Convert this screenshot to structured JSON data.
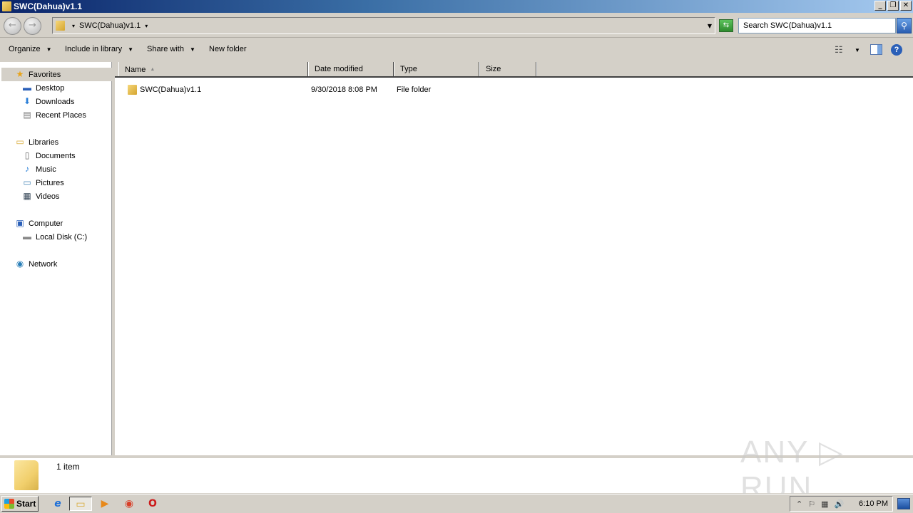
{
  "window": {
    "title": "SWC(Dahua)v1.1",
    "controls": {
      "minimize": "_",
      "restore": "❐",
      "close": "✕"
    }
  },
  "address_bar": {
    "breadcrumb": [
      "SWC(Dahua)v1.1"
    ],
    "back_icon": "←",
    "forward_icon": "→",
    "refresh_icon": "⇆",
    "search_placeholder": "Search SWC(Dahua)v1.1",
    "search_icon": "🔍"
  },
  "command_bar": {
    "organize": "Organize",
    "include_in_library": "Include in library",
    "share_with": "Share with",
    "new_folder": "New folder",
    "dropdown_arrow": "▼",
    "views_icon": "☷",
    "preview_icon": "◨",
    "help_icon": "?"
  },
  "nav_pane": {
    "groups": [
      {
        "label": "Favorites",
        "icon": "★",
        "selected": true,
        "items": [
          {
            "label": "Desktop",
            "icon": "▬"
          },
          {
            "label": "Downloads",
            "icon": "⬇"
          },
          {
            "label": "Recent Places",
            "icon": "▤"
          }
        ]
      },
      {
        "label": "Libraries",
        "icon": "▭",
        "items": [
          {
            "label": "Documents",
            "icon": "▯"
          },
          {
            "label": "Music",
            "icon": "♪"
          },
          {
            "label": "Pictures",
            "icon": "▭"
          },
          {
            "label": "Videos",
            "icon": "▦"
          }
        ]
      },
      {
        "label": "Computer",
        "icon": "▣",
        "items": [
          {
            "label": "Local Disk (C:)",
            "icon": "▬"
          }
        ]
      },
      {
        "label": "Network",
        "icon": "◉",
        "items": []
      }
    ]
  },
  "file_list": {
    "columns": [
      "Name",
      "Date modified",
      "Type",
      "Size"
    ],
    "sort_indicator": "▲",
    "rows": [
      {
        "name": "SWC(Dahua)v1.1",
        "date_modified": "9/30/2018 8:08 PM",
        "type": "File folder",
        "size": ""
      }
    ]
  },
  "details_pane": {
    "item_count": "1 item"
  },
  "watermark": "ANY ▷ RUN",
  "taskbar": {
    "start_label": "Start",
    "apps": [
      {
        "name": "Internet Explorer",
        "icon": "e"
      },
      {
        "name": "Windows Explorer",
        "icon": "▭",
        "active": true
      },
      {
        "name": "Windows Media Player",
        "icon": "▶"
      },
      {
        "name": "Chrome",
        "icon": "◉"
      },
      {
        "name": "Opera",
        "icon": "O"
      }
    ],
    "tray": {
      "show_hidden": "⌃",
      "flag_icon": "⚐",
      "network_icon": "▦",
      "volume_icon": "🔊",
      "clock": "6:10 PM"
    }
  }
}
